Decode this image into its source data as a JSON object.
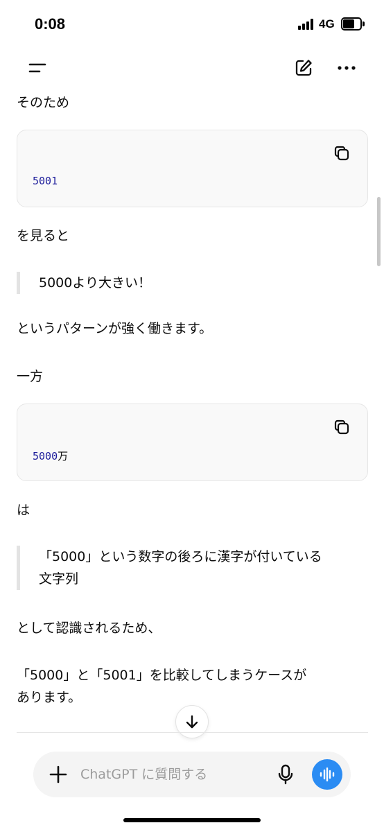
{
  "status_bar": {
    "time": "0:08",
    "network": "4G",
    "battery_level": 0.65
  },
  "top_nav": {
    "menu_icon": "menu-icon",
    "edit_icon": "new-chat-edit-icon",
    "more_icon": "more-horizontal-icon"
  },
  "conversation": {
    "p1": "そのため",
    "code1": {
      "digits": "5001",
      "suffix": ""
    },
    "p2": "を見ると",
    "quote1": "5000より大きい！",
    "p3": "というパターンが強く働きます。",
    "p4": "一方",
    "code2": {
      "digits": "5000",
      "suffix": "万"
    },
    "p5": "は",
    "quote2_line1": "「5000」という数字の後ろに漢字が付いている",
    "quote2_line2": "文字列",
    "p6": "として認識されるため、",
    "p7_line1": "「5000」と「5001」を比較してしまうケースが",
    "p7_line2": "あります。",
    "copy_icon": "copy-icon"
  },
  "composer": {
    "placeholder": "ChatGPT に質問する",
    "plus_icon": "plus-icon",
    "mic_icon": "microphone-icon",
    "voice_icon": "voice-waveform-icon",
    "accent_color": "#2b8cf3"
  }
}
